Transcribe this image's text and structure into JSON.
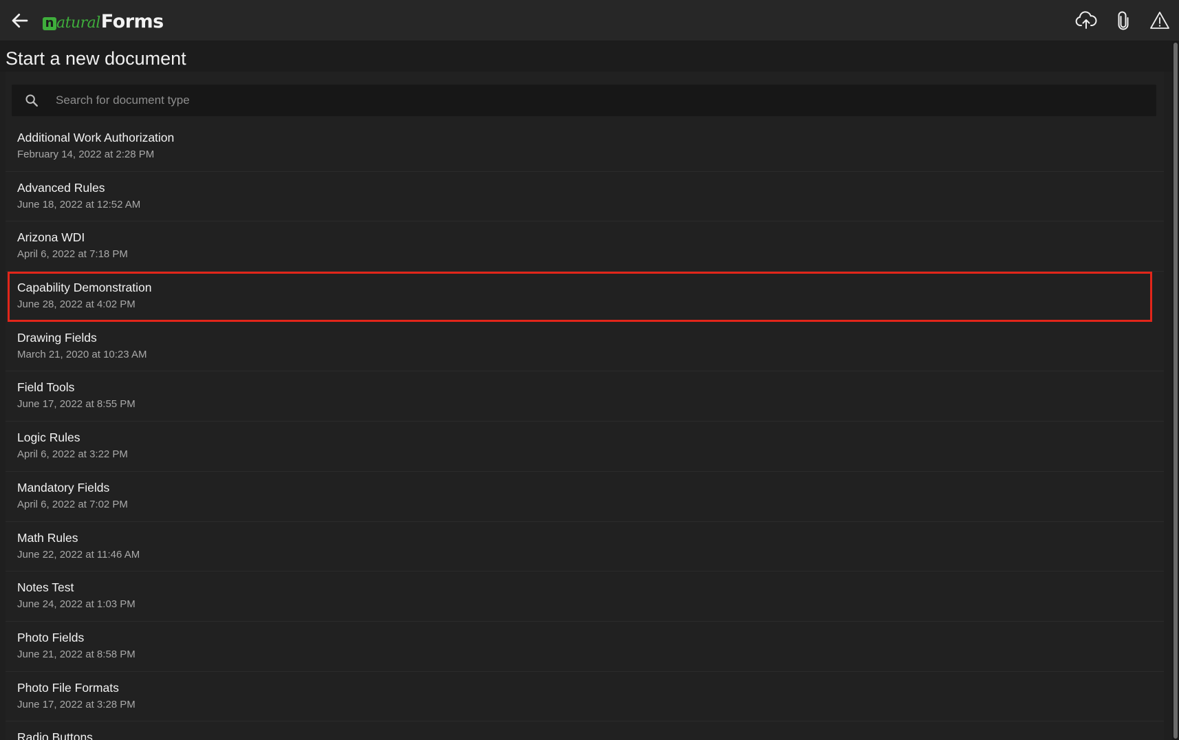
{
  "app": {
    "logo_badge": "n",
    "logo_natural": "atural",
    "logo_forms": "Forms"
  },
  "toolbar": {
    "back_icon": "arrow-left-icon",
    "icons": [
      "cloud-upload-icon",
      "paperclip-icon",
      "warning-icon"
    ]
  },
  "page": {
    "title": "Start a new document"
  },
  "search": {
    "placeholder": "Search for document type",
    "value": ""
  },
  "documents": [
    {
      "name": "Additional Work Authorization",
      "date": "February 14, 2022 at 2:28 PM"
    },
    {
      "name": "Advanced Rules",
      "date": "June 18, 2022 at 12:52 AM"
    },
    {
      "name": "Arizona WDI",
      "date": "April 6, 2022 at 7:18 PM"
    },
    {
      "name": "Capability Demonstration",
      "date": "June 28, 2022 at 4:02 PM",
      "selected": true
    },
    {
      "name": "Drawing Fields",
      "date": "March 21, 2020 at 10:23 AM"
    },
    {
      "name": "Field Tools",
      "date": "June 17, 2022 at 8:55 PM"
    },
    {
      "name": "Logic Rules",
      "date": "April 6, 2022 at 3:22 PM"
    },
    {
      "name": "Mandatory Fields",
      "date": "April 6, 2022 at 7:02 PM"
    },
    {
      "name": "Math Rules",
      "date": "June 22, 2022 at 11:46 AM"
    },
    {
      "name": "Notes Test",
      "date": "June 24, 2022 at 1:03 PM"
    },
    {
      "name": "Photo Fields",
      "date": "June 21, 2022 at 8:58 PM"
    },
    {
      "name": "Photo File Formats",
      "date": "June 17, 2022 at 3:28 PM"
    },
    {
      "name": "Radio Buttons",
      "date": ""
    }
  ],
  "colors": {
    "accent_green": "#3fae3c",
    "selection_red": "#e2261a",
    "background": "#1f1f1f"
  }
}
